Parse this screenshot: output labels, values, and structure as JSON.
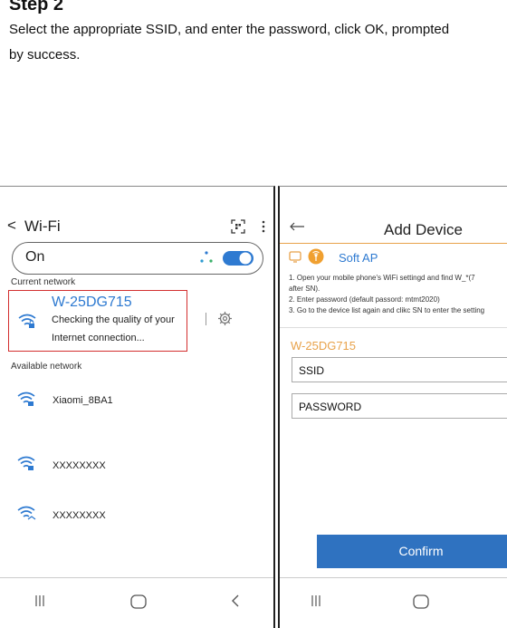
{
  "intro": {
    "step_label": "Step 2",
    "line1": "Select the appropriate SSID, and enter the password, click OK, prompted",
    "line2": "by success."
  },
  "left_phone": {
    "title": "Wi-Fi",
    "toggle_label": "On",
    "toggle_state": "on",
    "current_network_label": "Current network",
    "current_network": {
      "name": "W-25DG715",
      "status_line1": "Checking the quality of your",
      "status_line2": "Internet connection..."
    },
    "available_network_label": "Available network",
    "available_networks": [
      {
        "name": "Xiaomi_8BA1",
        "icon": "wifi-locked-icon"
      },
      {
        "name": "XXXXXXXX",
        "icon": "wifi-locked-icon"
      },
      {
        "name": "XXXXXXXX",
        "icon": "wifi-icon"
      }
    ],
    "accent_color": "#2e7ad1",
    "highlight_color": "#d32f2f"
  },
  "right_phone": {
    "title": "Add Device",
    "mode_label": "Soft AP",
    "instructions": [
      "1. Open your mobile phone's WiFi settingd and find W_*(7",
      "after SN).",
      "2. Enter password (default passord: mtmt2020)",
      "3. Go to the device list again and clikc SN to enter the setting"
    ],
    "device_name": "W-25DG715",
    "ssid_placeholder": "SSID",
    "password_placeholder": "PASSWORD",
    "confirm_label": "Confirm",
    "button_color": "#2f72c0",
    "device_color": "#e8a24a"
  }
}
